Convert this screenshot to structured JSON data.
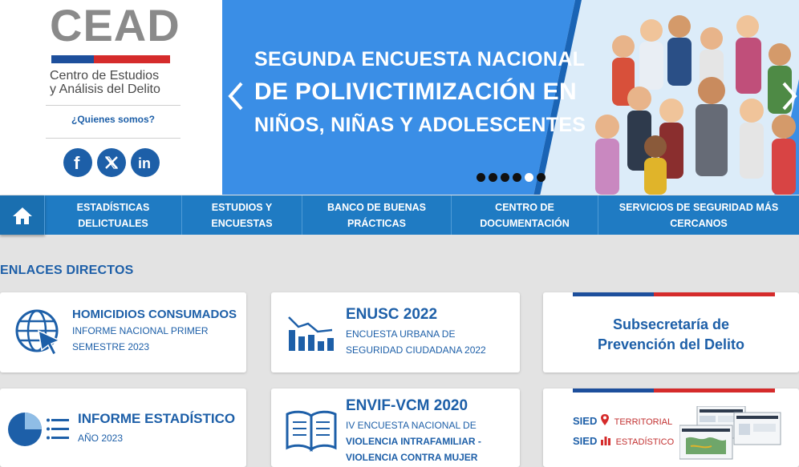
{
  "logo": {
    "brand": "CEAD",
    "subtitle_line1": "Centro de Estudios",
    "subtitle_line2": "y Análisis del Delito",
    "about_link": "¿Quienes somos?"
  },
  "socials": [
    {
      "name": "facebook-icon",
      "glyph": "f"
    },
    {
      "name": "x-twitter-icon",
      "glyph": "𝕏"
    },
    {
      "name": "linkedin-icon",
      "glyph": "in"
    }
  ],
  "banner": {
    "line1": "SEGUNDA ENCUESTA NACIONAL",
    "line2": "DE POLIVICTIMIZACIÓN EN",
    "line3": "NIÑOS, NIÑAS Y ADOLESCENTES",
    "prev": "‹",
    "next": "›",
    "slide_count": 6,
    "active_slide": 5
  },
  "nav": {
    "home_icon": "home-icon",
    "items": [
      {
        "line1": "ESTADÍSTICAS",
        "line2": "DELICTUALES"
      },
      {
        "line1": "ESTUDIOS Y",
        "line2": "ENCUESTAS"
      },
      {
        "line1": "BANCO DE BUENAS",
        "line2": "PRÁCTICAS"
      },
      {
        "line1": "CENTRO DE",
        "line2": "DOCUMENTACIÓN"
      },
      {
        "line1": "SERVICIOS DE SEGURIDAD MÁS",
        "line2": "CERCANOS"
      }
    ]
  },
  "section_title": "ENLACES DIRECTOS",
  "cards": {
    "homicidios": {
      "title": "HOMICIDIOS CONSUMADOS",
      "sub1": "INFORME NACIONAL PRIMER",
      "sub2": "SEMESTRE 2023",
      "icon": "globe-cursor-icon"
    },
    "enusc": {
      "title": "ENUSC 2022",
      "sub1": "ENCUESTA URBANA DE",
      "sub2": "SEGURIDAD CIUDADANA 2022",
      "icon": "bar-chart-icon"
    },
    "subsecretaria": {
      "line1": "Subsecretaría de",
      "line2": "Prevención del Delito"
    },
    "informe": {
      "title": "INFORME ESTADÍSTICO",
      "sub1": "AÑO 2023",
      "icon": "pie-chart-icon"
    },
    "envif": {
      "title": "ENVIF-VCM 2020",
      "sub1": "IV ENCUESTA NACIONAL DE",
      "sub2": "VIOLENCIA INTRAFAMILIAR -",
      "sub3": "VIOLENCIA CONTRA MUJER",
      "icon": "open-book-icon"
    },
    "sied": {
      "sied1": "SIED",
      "label1": "TERRITORIAL",
      "sied2": "SIED",
      "label2": "ESTADÍSTICO"
    }
  },
  "colors": {
    "primary": "#1d5fa8",
    "nav": "#1f7bc3",
    "banner": "#3a8ee6",
    "flag_red": "#d52b2b",
    "flag_blue": "#1d4f9c"
  }
}
